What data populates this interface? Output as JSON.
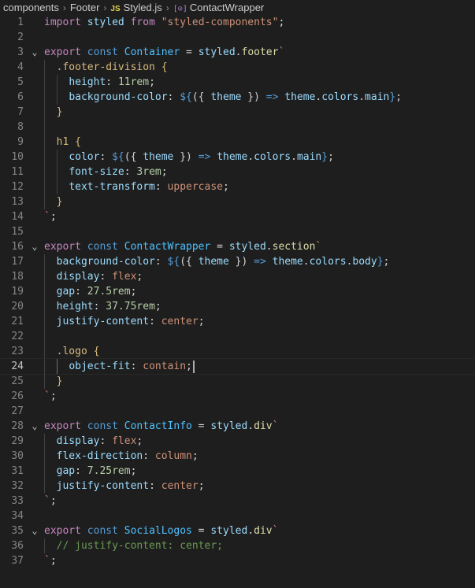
{
  "breadcrumb": [
    {
      "label": "components",
      "icon": ""
    },
    {
      "label": "Footer",
      "icon": ""
    },
    {
      "label": "Styled.js",
      "icon": "js-file-icon",
      "icon_text": "JS"
    },
    {
      "label": "ContactWrapper",
      "icon": "symbol-variable-icon",
      "icon_text": "[⊙]"
    }
  ],
  "editor": {
    "current_line": 24,
    "lines": [
      {
        "n": "1",
        "fold": false,
        "tokens": [
          [
            "import",
            "t-keyword"
          ],
          [
            " ",
            "t-text"
          ],
          [
            "styled",
            "t-var"
          ],
          [
            " ",
            "t-text"
          ],
          [
            "from",
            "t-keyword"
          ],
          [
            " ",
            "t-text"
          ],
          [
            "\"styled-components\"",
            "t-string"
          ],
          [
            ";",
            "t-punc"
          ]
        ]
      },
      {
        "n": "2",
        "fold": false,
        "tokens": []
      },
      {
        "n": "3",
        "fold": true,
        "tokens": [
          [
            "export",
            "t-keyword"
          ],
          [
            " ",
            "t-text"
          ],
          [
            "const",
            "t-storage"
          ],
          [
            " ",
            "t-text"
          ],
          [
            "Container",
            "t-const"
          ],
          [
            " = ",
            "t-text"
          ],
          [
            "styled",
            "t-var"
          ],
          [
            ".",
            "t-punc"
          ],
          [
            "footer",
            "t-func"
          ],
          [
            "`",
            "t-string"
          ]
        ]
      },
      {
        "n": "4",
        "fold": false,
        "indent": 1,
        "tokens": [
          [
            ".footer-division {",
            "t-sel"
          ]
        ]
      },
      {
        "n": "5",
        "fold": false,
        "indent": 2,
        "tokens": [
          [
            "height",
            "t-prop"
          ],
          [
            ": ",
            "t-text"
          ],
          [
            "11rem",
            "t-number"
          ],
          [
            ";",
            "t-punc"
          ]
        ]
      },
      {
        "n": "6",
        "fold": false,
        "indent": 2,
        "tokens": [
          [
            "background-color",
            "t-prop"
          ],
          [
            ": ",
            "t-text"
          ],
          [
            "${",
            "t-interp"
          ],
          [
            "({ ",
            "t-text"
          ],
          [
            "theme",
            "t-var"
          ],
          [
            " }) ",
            "t-text"
          ],
          [
            "=>",
            "t-arrow"
          ],
          [
            " ",
            "t-text"
          ],
          [
            "theme",
            "t-var"
          ],
          [
            ".",
            "t-punc"
          ],
          [
            "colors",
            "t-var"
          ],
          [
            ".",
            "t-punc"
          ],
          [
            "main",
            "t-var"
          ],
          [
            "}",
            "t-interp"
          ],
          [
            ";",
            "t-punc"
          ]
        ]
      },
      {
        "n": "7",
        "fold": false,
        "indent": 1,
        "tokens": [
          [
            "}",
            "t-sel"
          ]
        ]
      },
      {
        "n": "8",
        "fold": false,
        "indent": 1,
        "tokens": []
      },
      {
        "n": "9",
        "fold": false,
        "indent": 1,
        "tokens": [
          [
            "h1 {",
            "t-sel"
          ]
        ]
      },
      {
        "n": "10",
        "fold": false,
        "indent": 2,
        "tokens": [
          [
            "color",
            "t-prop"
          ],
          [
            ": ",
            "t-text"
          ],
          [
            "${",
            "t-interp"
          ],
          [
            "({ ",
            "t-text"
          ],
          [
            "theme",
            "t-var"
          ],
          [
            " }) ",
            "t-text"
          ],
          [
            "=>",
            "t-arrow"
          ],
          [
            " ",
            "t-text"
          ],
          [
            "theme",
            "t-var"
          ],
          [
            ".",
            "t-punc"
          ],
          [
            "colors",
            "t-var"
          ],
          [
            ".",
            "t-punc"
          ],
          [
            "main",
            "t-var"
          ],
          [
            "}",
            "t-interp"
          ],
          [
            ";",
            "t-punc"
          ]
        ]
      },
      {
        "n": "11",
        "fold": false,
        "indent": 2,
        "tokens": [
          [
            "font-size",
            "t-prop"
          ],
          [
            ": ",
            "t-text"
          ],
          [
            "3rem",
            "t-number"
          ],
          [
            ";",
            "t-punc"
          ]
        ]
      },
      {
        "n": "12",
        "fold": false,
        "indent": 2,
        "tokens": [
          [
            "text-transform",
            "t-prop"
          ],
          [
            ": ",
            "t-text"
          ],
          [
            "uppercase",
            "t-value"
          ],
          [
            ";",
            "t-punc"
          ]
        ]
      },
      {
        "n": "13",
        "fold": false,
        "indent": 1,
        "tokens": [
          [
            "}",
            "t-sel"
          ]
        ]
      },
      {
        "n": "14",
        "fold": false,
        "tokens": [
          [
            "`",
            "t-string"
          ],
          [
            ";",
            "t-punc"
          ]
        ]
      },
      {
        "n": "15",
        "fold": false,
        "tokens": []
      },
      {
        "n": "16",
        "fold": true,
        "tokens": [
          [
            "export",
            "t-keyword"
          ],
          [
            " ",
            "t-text"
          ],
          [
            "const",
            "t-storage"
          ],
          [
            " ",
            "t-text"
          ],
          [
            "ContactWrapper",
            "t-const"
          ],
          [
            " = ",
            "t-text"
          ],
          [
            "styled",
            "t-var"
          ],
          [
            ".",
            "t-punc"
          ],
          [
            "section",
            "t-func"
          ],
          [
            "`",
            "t-string"
          ]
        ]
      },
      {
        "n": "17",
        "fold": false,
        "indent": 1,
        "tokens": [
          [
            "background-color",
            "t-prop"
          ],
          [
            ": ",
            "t-text"
          ],
          [
            "${",
            "t-interp"
          ],
          [
            "({ ",
            "t-text"
          ],
          [
            "theme",
            "t-var"
          ],
          [
            " }) ",
            "t-text"
          ],
          [
            "=>",
            "t-arrow"
          ],
          [
            " ",
            "t-text"
          ],
          [
            "theme",
            "t-var"
          ],
          [
            ".",
            "t-punc"
          ],
          [
            "colors",
            "t-var"
          ],
          [
            ".",
            "t-punc"
          ],
          [
            "body",
            "t-var"
          ],
          [
            "}",
            "t-interp"
          ],
          [
            ";",
            "t-punc"
          ]
        ]
      },
      {
        "n": "18",
        "fold": false,
        "indent": 1,
        "tokens": [
          [
            "display",
            "t-prop"
          ],
          [
            ": ",
            "t-text"
          ],
          [
            "flex",
            "t-value"
          ],
          [
            ";",
            "t-punc"
          ]
        ]
      },
      {
        "n": "19",
        "fold": false,
        "indent": 1,
        "tokens": [
          [
            "gap",
            "t-prop"
          ],
          [
            ": ",
            "t-text"
          ],
          [
            "27.5rem",
            "t-number"
          ],
          [
            ";",
            "t-punc"
          ]
        ]
      },
      {
        "n": "20",
        "fold": false,
        "indent": 1,
        "tokens": [
          [
            "height",
            "t-prop"
          ],
          [
            ": ",
            "t-text"
          ],
          [
            "37.75rem",
            "t-number"
          ],
          [
            ";",
            "t-punc"
          ]
        ]
      },
      {
        "n": "21",
        "fold": false,
        "indent": 1,
        "tokens": [
          [
            "justify-content",
            "t-prop"
          ],
          [
            ": ",
            "t-text"
          ],
          [
            "center",
            "t-value"
          ],
          [
            ";",
            "t-punc"
          ]
        ]
      },
      {
        "n": "22",
        "fold": false,
        "indent": 1,
        "tokens": []
      },
      {
        "n": "23",
        "fold": false,
        "indent": 1,
        "tokens": [
          [
            ".logo {",
            "t-sel"
          ]
        ]
      },
      {
        "n": "24",
        "fold": false,
        "indent": 2,
        "cursor": true,
        "tokens": [
          [
            "object-fit",
            "t-prop"
          ],
          [
            ": ",
            "t-text"
          ],
          [
            "contain",
            "t-value"
          ],
          [
            ";",
            "t-punc"
          ]
        ]
      },
      {
        "n": "25",
        "fold": false,
        "indent": 1,
        "tokens": [
          [
            "}",
            "t-sel"
          ]
        ]
      },
      {
        "n": "26",
        "fold": false,
        "tokens": [
          [
            "`",
            "t-string"
          ],
          [
            ";",
            "t-punc"
          ]
        ]
      },
      {
        "n": "27",
        "fold": false,
        "tokens": []
      },
      {
        "n": "28",
        "fold": true,
        "tokens": [
          [
            "export",
            "t-keyword"
          ],
          [
            " ",
            "t-text"
          ],
          [
            "const",
            "t-storage"
          ],
          [
            " ",
            "t-text"
          ],
          [
            "ContactInfo",
            "t-const"
          ],
          [
            " = ",
            "t-text"
          ],
          [
            "styled",
            "t-var"
          ],
          [
            ".",
            "t-punc"
          ],
          [
            "div",
            "t-func"
          ],
          [
            "`",
            "t-string"
          ]
        ]
      },
      {
        "n": "29",
        "fold": false,
        "indent": 1,
        "tokens": [
          [
            "display",
            "t-prop"
          ],
          [
            ": ",
            "t-text"
          ],
          [
            "flex",
            "t-value"
          ],
          [
            ";",
            "t-punc"
          ]
        ]
      },
      {
        "n": "30",
        "fold": false,
        "indent": 1,
        "tokens": [
          [
            "flex-direction",
            "t-prop"
          ],
          [
            ": ",
            "t-text"
          ],
          [
            "column",
            "t-value"
          ],
          [
            ";",
            "t-punc"
          ]
        ]
      },
      {
        "n": "31",
        "fold": false,
        "indent": 1,
        "tokens": [
          [
            "gap",
            "t-prop"
          ],
          [
            ": ",
            "t-text"
          ],
          [
            "7.25rem",
            "t-number"
          ],
          [
            ";",
            "t-punc"
          ]
        ]
      },
      {
        "n": "32",
        "fold": false,
        "indent": 1,
        "tokens": [
          [
            "justify-content",
            "t-prop"
          ],
          [
            ": ",
            "t-text"
          ],
          [
            "center",
            "t-value"
          ],
          [
            ";",
            "t-punc"
          ]
        ]
      },
      {
        "n": "33",
        "fold": false,
        "tokens": [
          [
            "`",
            "t-string"
          ],
          [
            ";",
            "t-punc"
          ]
        ]
      },
      {
        "n": "34",
        "fold": false,
        "tokens": []
      },
      {
        "n": "35",
        "fold": true,
        "tokens": [
          [
            "export",
            "t-keyword"
          ],
          [
            " ",
            "t-text"
          ],
          [
            "const",
            "t-storage"
          ],
          [
            " ",
            "t-text"
          ],
          [
            "SocialLogos",
            "t-const"
          ],
          [
            " = ",
            "t-text"
          ],
          [
            "styled",
            "t-var"
          ],
          [
            ".",
            "t-punc"
          ],
          [
            "div",
            "t-func"
          ],
          [
            "`",
            "t-string"
          ]
        ]
      },
      {
        "n": "36",
        "fold": false,
        "indent": 1,
        "tokens": [
          [
            "// justify-content: center;",
            "t-comment"
          ]
        ]
      },
      {
        "n": "37",
        "fold": false,
        "tokens": [
          [
            "`",
            "t-string"
          ],
          [
            ";",
            "t-punc"
          ]
        ]
      }
    ]
  }
}
